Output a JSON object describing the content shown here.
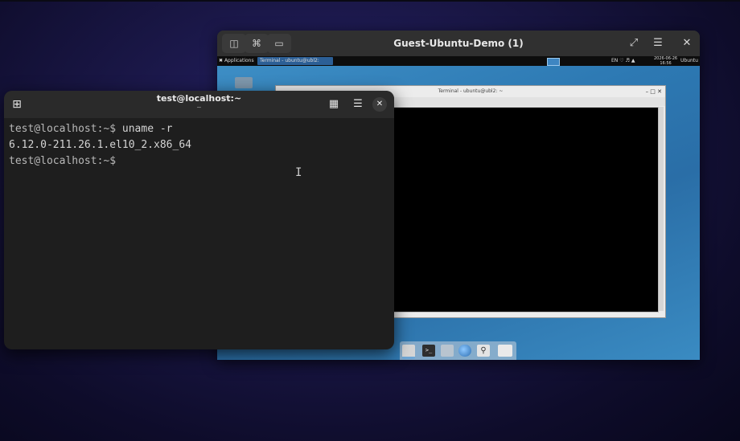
{
  "viewer": {
    "title": "Guest-Ubuntu-Demo (1)",
    "icons": [
      "display-icon",
      "keyboard-shortcut-icon",
      "monitor-icon",
      "fullscreen-icon",
      "menu-icon",
      "close-icon"
    ]
  },
  "guest": {
    "panel": {
      "applications": "Applications",
      "task": "Terminal - ubuntu@ubl2:",
      "lang": "EN",
      "clock": "2026-06-26\n16:56",
      "user": "Ubuntu"
    },
    "terminal_title": "Terminal - ubuntu@ubl2: ~",
    "dock_icons": [
      "show-desktop-icon",
      "terminal-icon",
      "home-folder-icon",
      "browser-icon",
      "search-icon",
      "files-icon"
    ]
  },
  "terminal": {
    "title": "test@localhost:~",
    "subtitle": "~",
    "lines": [
      {
        "prompt": "test@localhost:~$ ",
        "text": "uname -r"
      },
      {
        "prompt": "",
        "text": "6.12.0-211.26.1.el10_2.x86_64"
      },
      {
        "prompt": "test@localhost:~$",
        "text": ""
      }
    ],
    "cursor": "I"
  }
}
